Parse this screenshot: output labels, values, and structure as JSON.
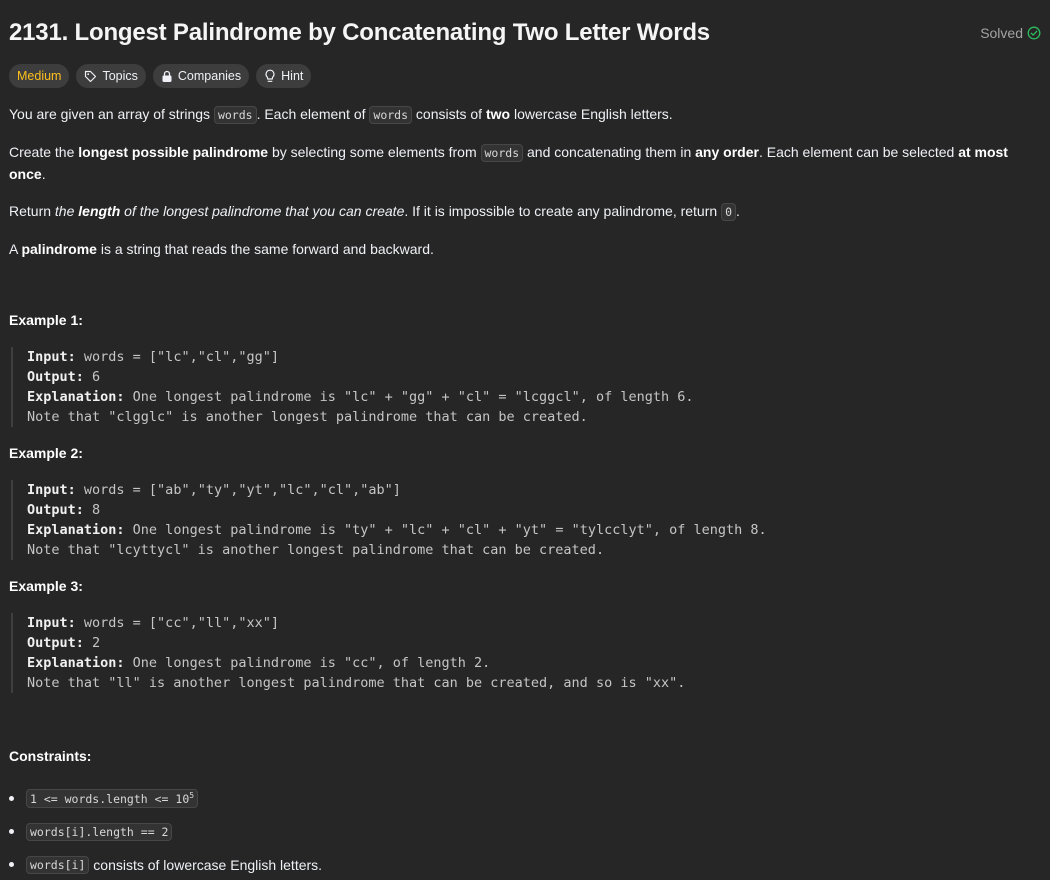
{
  "header": {
    "title": "2131. Longest Palindrome by Concatenating Two Letter Words",
    "status": "Solved"
  },
  "tags": {
    "difficulty": "Medium",
    "topics": "Topics",
    "companies": "Companies",
    "hint": "Hint"
  },
  "description": {
    "p1_a": "You are given an array of strings ",
    "p1_code1": "words",
    "p1_b": ". Each element of ",
    "p1_code2": "words",
    "p1_c": " consists of ",
    "p1_bold": "two",
    "p1_d": " lowercase English letters.",
    "p2_a": "Create the ",
    "p2_bold1": "longest possible palindrome",
    "p2_b": " by selecting some elements from ",
    "p2_code": "words",
    "p2_c": " and concatenating them in ",
    "p2_bold2": "any order",
    "p2_d": ". Each element can be selected ",
    "p2_bold3": "at most once",
    "p2_e": ".",
    "p3_a": "Return ",
    "p3_i1": "the ",
    "p3_bi": "length",
    "p3_i2": " of the longest palindrome that you can create",
    "p3_b": ". If it is impossible to create any palindrome, return ",
    "p3_code": "0",
    "p3_c": ".",
    "p4_a": "A ",
    "p4_bold": "palindrome",
    "p4_b": " is a string that reads the same forward and backward."
  },
  "examples": [
    {
      "title": "Example 1:",
      "input_label": "Input:",
      "input": " words = [\"lc\",\"cl\",\"gg\"]",
      "output_label": "Output:",
      "output": " 6",
      "explanation_label": "Explanation:",
      "explanation": " One longest palindrome is \"lc\" + \"gg\" + \"cl\" = \"lcggcl\", of length 6.",
      "note": "Note that \"clgglc\" is another longest palindrome that can be created."
    },
    {
      "title": "Example 2:",
      "input_label": "Input:",
      "input": " words = [\"ab\",\"ty\",\"yt\",\"lc\",\"cl\",\"ab\"]",
      "output_label": "Output:",
      "output": " 8",
      "explanation_label": "Explanation:",
      "explanation": " One longest palindrome is \"ty\" + \"lc\" + \"cl\" + \"yt\" = \"tylcclyt\", of length 8.",
      "note": "Note that \"lcyttycl\" is another longest palindrome that can be created."
    },
    {
      "title": "Example 3:",
      "input_label": "Input:",
      "input": " words = [\"cc\",\"ll\",\"xx\"]",
      "output_label": "Output:",
      "output": " 2",
      "explanation_label": "Explanation:",
      "explanation": " One longest palindrome is \"cc\", of length 2.",
      "note": "Note that \"ll\" is another longest palindrome that can be created, and so is \"xx\"."
    }
  ],
  "constraints": {
    "title": "Constraints:",
    "c1_code": "1 <= words.length <= 10",
    "c1_sup": "5",
    "c2_code": "words[i].length == 2",
    "c3_code": "words[i]",
    "c3_text": " consists of lowercase English letters."
  },
  "colors": {
    "background": "#262626",
    "medium": "#ffc01e",
    "solved_check": "#2cbb5d"
  }
}
